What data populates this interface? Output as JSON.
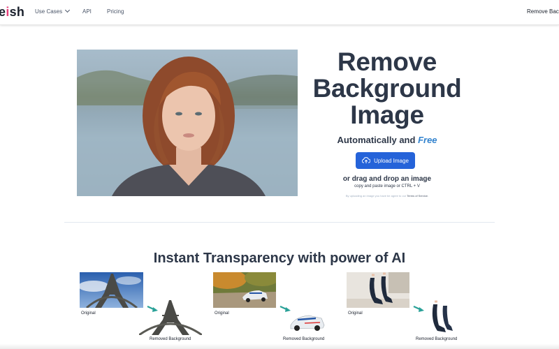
{
  "nav": {
    "logo_prefix": "e",
    "logo_dot": "i",
    "logo_suffix": "sh",
    "use_cases": "Use Cases",
    "api": "API",
    "pricing": "Pricing",
    "right_link": "Remove Back"
  },
  "hero": {
    "title_line1": "Remove",
    "title_line2": "Background",
    "title_line3": "Image",
    "subtitle": "Automatically and",
    "subtitle_highlight": "Free",
    "upload_label": "Upload Image",
    "drag_text": "or drag and drop an image",
    "paste_text": "copy and paste image or CTRL + V",
    "terms_prefix": "By uploading an image you have be agree to our",
    "terms_link": "Terms of Service."
  },
  "section": {
    "title": "Instant Transparency with power of AI"
  },
  "examples": [
    {
      "original_label": "Original",
      "result_label": "Removed Background",
      "icon": "eiffel-tower"
    },
    {
      "original_label": "Original",
      "result_label": "Removed Background",
      "icon": "rally-car"
    },
    {
      "original_label": "Original",
      "result_label": "Removed Background",
      "icon": "high-heel-shoes"
    }
  ],
  "colors": {
    "accent_blue": "#2563d9",
    "free_blue": "#3182ce",
    "arrow_teal": "#2aa198",
    "heading": "#2d3748",
    "logo_dot": "#e53e7a"
  }
}
